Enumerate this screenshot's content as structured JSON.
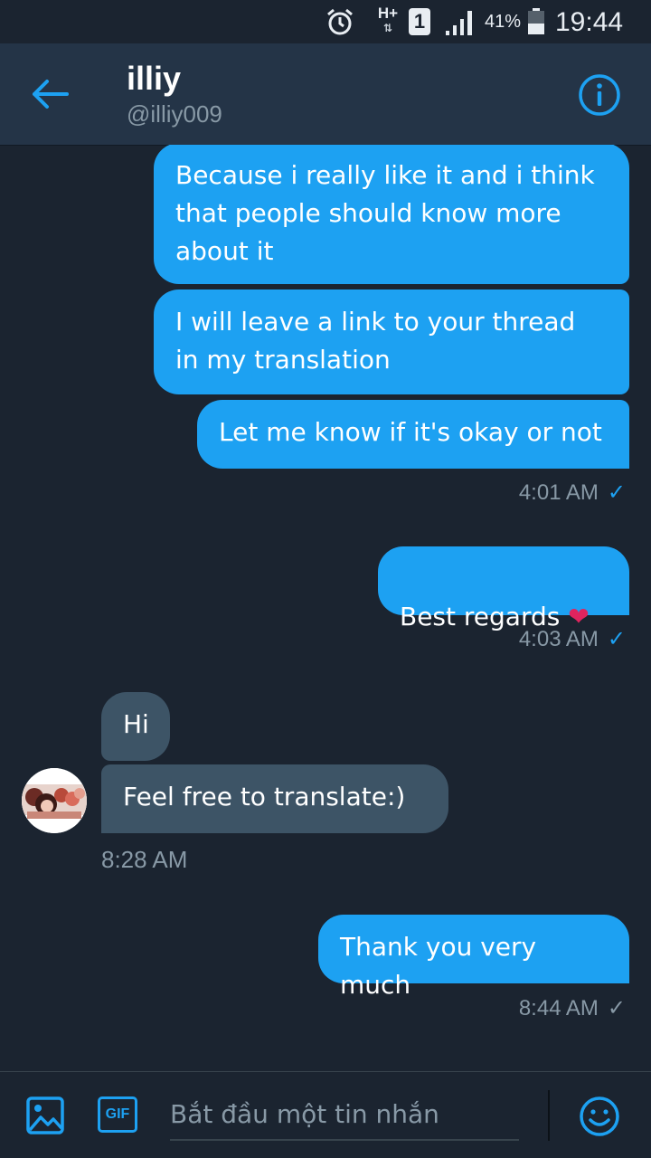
{
  "status_bar": {
    "network": "H+",
    "network_arrows": "⇅",
    "sim": "1",
    "battery": "41%",
    "time": "19:44",
    "icons": [
      "alarm-icon",
      "signal-icon",
      "battery-icon"
    ]
  },
  "header": {
    "name": "illiy",
    "handle": "@illiy009",
    "icons": [
      "back-arrow-icon",
      "info-icon"
    ]
  },
  "messages": [
    {
      "dir": "sent",
      "text": "Because i really like it and i think\nthat people should know more\nabout it"
    },
    {
      "dir": "sent",
      "text": "I will leave a link to your thread\nin my translation"
    },
    {
      "dir": "sent",
      "text": "Let me know if it's okay or not",
      "time": "4:01 AM",
      "status": "read"
    },
    {
      "dir": "sent",
      "text": "Best regards",
      "emoji": "❤",
      "time": "4:03 AM",
      "status": "read"
    },
    {
      "dir": "recv",
      "text": "Hi"
    },
    {
      "dir": "recv",
      "text": "Feel free to translate:)",
      "time": "8:28 AM"
    },
    {
      "dir": "sent",
      "text": "Thank you very much",
      "time": "8:44 AM",
      "status": "sent"
    }
  ],
  "checkmark": "✓",
  "composer": {
    "placeholder": "Bắt đầu một tin nhắn",
    "gif_label": "GIF",
    "icons": [
      "image-icon",
      "gif-icon",
      "emoji-icon"
    ]
  },
  "colors": {
    "background": "#1b2430",
    "header": "#243447",
    "accent": "#1da1f2",
    "received_bubble": "#3d5466",
    "muted_text": "#8899a6"
  }
}
